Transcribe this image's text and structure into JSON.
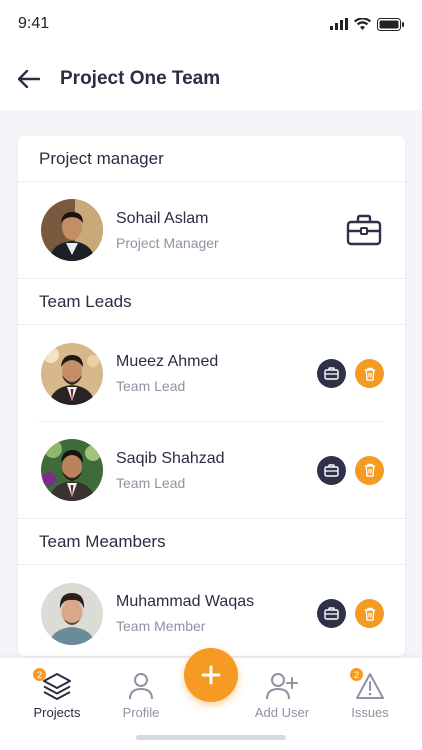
{
  "status_bar": {
    "time": "9:41"
  },
  "header": {
    "title": "Project One Team"
  },
  "sections": {
    "manager": {
      "title": "Project manager",
      "member": {
        "name": "Sohail Aslam",
        "role": "Project Manager"
      }
    },
    "leads": {
      "title": "Team Leads",
      "members": [
        {
          "name": "Mueez Ahmed",
          "role": "Team Lead"
        },
        {
          "name": "Saqib Shahzad",
          "role": "Team Lead"
        }
      ]
    },
    "team": {
      "title": "Team Meambers",
      "members": [
        {
          "name": "Muhammad Waqas",
          "role": "Team Member"
        }
      ]
    }
  },
  "nav": {
    "items": [
      {
        "label": "Projects",
        "badge": "2",
        "icon": "layers-icon"
      },
      {
        "label": "Profile",
        "icon": "user-icon"
      },
      {
        "label": "Add User",
        "icon": "add-user-icon"
      },
      {
        "label": "Issues",
        "badge": "2",
        "icon": "warning-icon"
      }
    ],
    "fab_icon": "plus-icon"
  },
  "colors": {
    "accent": "#f59a23",
    "dark": "#2e3148",
    "text": "#2b2d42",
    "muted": "#8e93a2"
  }
}
